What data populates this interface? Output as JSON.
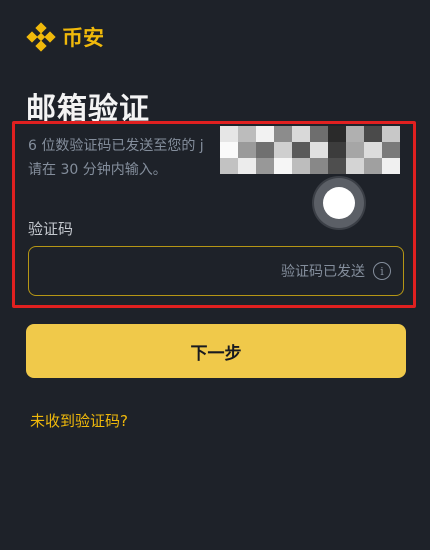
{
  "brand": {
    "name": "币安",
    "color": "#f0b90b"
  },
  "page": {
    "title": "邮箱验证"
  },
  "description": {
    "line1": "6 位数验证码已发送至您的 j",
    "line2": "请在 30 分钟内输入。"
  },
  "code_field": {
    "label": "验证码",
    "value": "",
    "status_text": "验证码已发送",
    "info_icon": "i"
  },
  "actions": {
    "next_label": "下一步",
    "resend_label": "未收到验证码?"
  },
  "colors": {
    "background": "#1e2229",
    "accent": "#f0b90b",
    "button": "#f0c94a",
    "annotation": "#e02020"
  }
}
